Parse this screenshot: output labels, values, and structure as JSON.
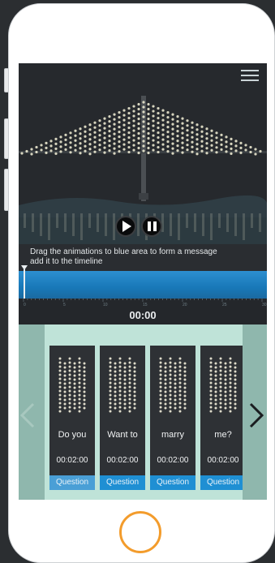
{
  "app": {
    "menu_icon": "hamburger-menu-icon",
    "instruction": "Drag the animations to blue area to form a message\nadd it to  the timeline",
    "instruction_line1": "Drag the animations to blue area to form a message",
    "instruction_line2": "add it to  the timeline",
    "time": "00:00",
    "timeline_ticks": [
      "0",
      "5",
      "10",
      "15",
      "20",
      "25",
      "30"
    ],
    "controls": {
      "play_icon": "play-icon",
      "pause_icon": "pause-icon"
    }
  },
  "cards": [
    {
      "word": "Do you",
      "duration": "00:02:00",
      "tag": "Question"
    },
    {
      "word": "Want to",
      "duration": "00:02:00",
      "tag": "Question"
    },
    {
      "word": "marry",
      "duration": "00:02:00",
      "tag": "Question"
    },
    {
      "word": "me?",
      "duration": "00:02:00",
      "tag": "Question"
    }
  ],
  "colors": {
    "accent": "#1f8fd3",
    "home_button": "#f39c2c",
    "carousel_bg": "#bfe3d8"
  }
}
